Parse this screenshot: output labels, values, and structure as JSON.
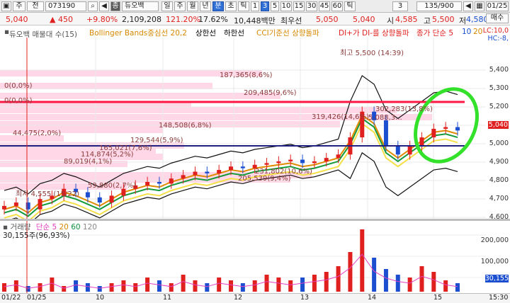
{
  "toolbar": {
    "period_label": "주",
    "type_label": "전",
    "code": "073190",
    "name_tag": "종",
    "stock_name": "듀오백",
    "intervals": [
      "일",
      "주",
      "월",
      "년",
      "분",
      "초",
      "틱",
      "1",
      "3",
      "5",
      "10",
      "15",
      "30",
      "45",
      "60",
      "틱"
    ],
    "selected_interval": "분",
    "selected_num": "3",
    "minute_value": "3",
    "count": "135/900",
    "date_label": "01/25"
  },
  "quote": {
    "price": "5,040",
    "change": "450",
    "change_pct": "+9.80%",
    "volume": "2,109,208",
    "vol_ratio": "121.20%",
    "turnover_pct": "17.62%",
    "amount": "10,448백만",
    "best_label": "최우선",
    "ask": "5,050",
    "bid": "5,040",
    "open_label": "시",
    "open": "4,585",
    "high_label": "고",
    "high": "5,500",
    "low_label": "저",
    "low": "4,580",
    "buy_label": "매수"
  },
  "legend": {
    "title": "듀오백 매물대 수(15)",
    "bb": "Bollinger Bands중심선 20,2",
    "upper": "상한선",
    "lower": "하한선",
    "cci": "CCI기준선 상향돌파",
    "di": "DI+가 DI-를 상향돌파",
    "ma": "종가 단순 5",
    "ma10": "10",
    "ma20": "20"
  },
  "price_axis": [
    "5,400",
    "5,300",
    "5,200",
    "5,100",
    "5,000",
    "4,900",
    "4,800",
    "4,700",
    "4,600"
  ],
  "right_small": [
    "LC:10,0",
    "HC:-8,"
  ],
  "volume_profile": [
    {
      "label": "187,365(8,6%)"
    },
    {
      "label": "0(0,0%)"
    },
    {
      "label": "209,485(9,6%)"
    },
    {
      "label": "0(0,0%)"
    },
    {
      "label": "302,283(13,8%)"
    },
    {
      "label": "319,426(14,6%)"
    },
    {
      "label": "5,088,3..."
    },
    {
      "label": "148,508(6,8%)"
    },
    {
      "label": "44,475(2,0%)"
    },
    {
      "label": "129,544(5,9%)"
    },
    {
      "label": "165,021(7,6%)"
    },
    {
      "label": "114,874(5,2%)"
    },
    {
      "label": "89,019(4,1%)"
    },
    {
      "label": "231,802(10,6%)"
    },
    {
      "label": "205,539(9,4%)"
    },
    {
      "label": "59,880(2,7%)"
    }
  ],
  "annotations": {
    "max": "최고 5,500 (14:39)",
    "min": "최저 4,555 (15/22)"
  },
  "volume_legend": {
    "title": "거래량",
    "ma": "단순 5",
    "p20": "20",
    "p60": "60",
    "p120": "120",
    "value": "30,155주(96,93%)"
  },
  "vol_axis": [
    "200,000",
    "100,000",
    "30,155"
  ],
  "time_axis": [
    "01/22",
    "01/25",
    "10",
    "11",
    "12",
    "13",
    "14",
    "15",
    "15:30"
  ],
  "colors": {
    "up": "#e0201f",
    "down": "#1c4fd0",
    "highlight": "#33e02a",
    "resistance": "#ff0033"
  },
  "chart_data": {
    "type": "candlestick",
    "y_range": [
      4550,
      5500
    ],
    "close_series": [
      4600,
      4620,
      4580,
      4640,
      4660,
      4700,
      4680,
      4650,
      4620,
      4660,
      4700,
      4720,
      4740,
      4730,
      4760,
      4780,
      4800,
      4790,
      4810,
      4830,
      4820,
      4840,
      4850,
      4860,
      4870,
      4850,
      4860,
      4880,
      4900,
      5000,
      5150,
      5100,
      4950,
      4900,
      4950,
      5000,
      5050,
      5060,
      5040
    ],
    "volume_series": [
      3,
      4,
      2,
      3,
      5,
      2,
      4,
      3,
      2,
      3,
      4,
      3,
      5,
      4,
      3,
      6,
      4,
      3,
      5,
      4,
      3,
      4,
      6,
      5,
      4,
      5,
      6,
      7,
      9,
      14,
      22,
      12,
      8,
      6,
      5,
      9,
      7,
      4,
      3
    ]
  }
}
